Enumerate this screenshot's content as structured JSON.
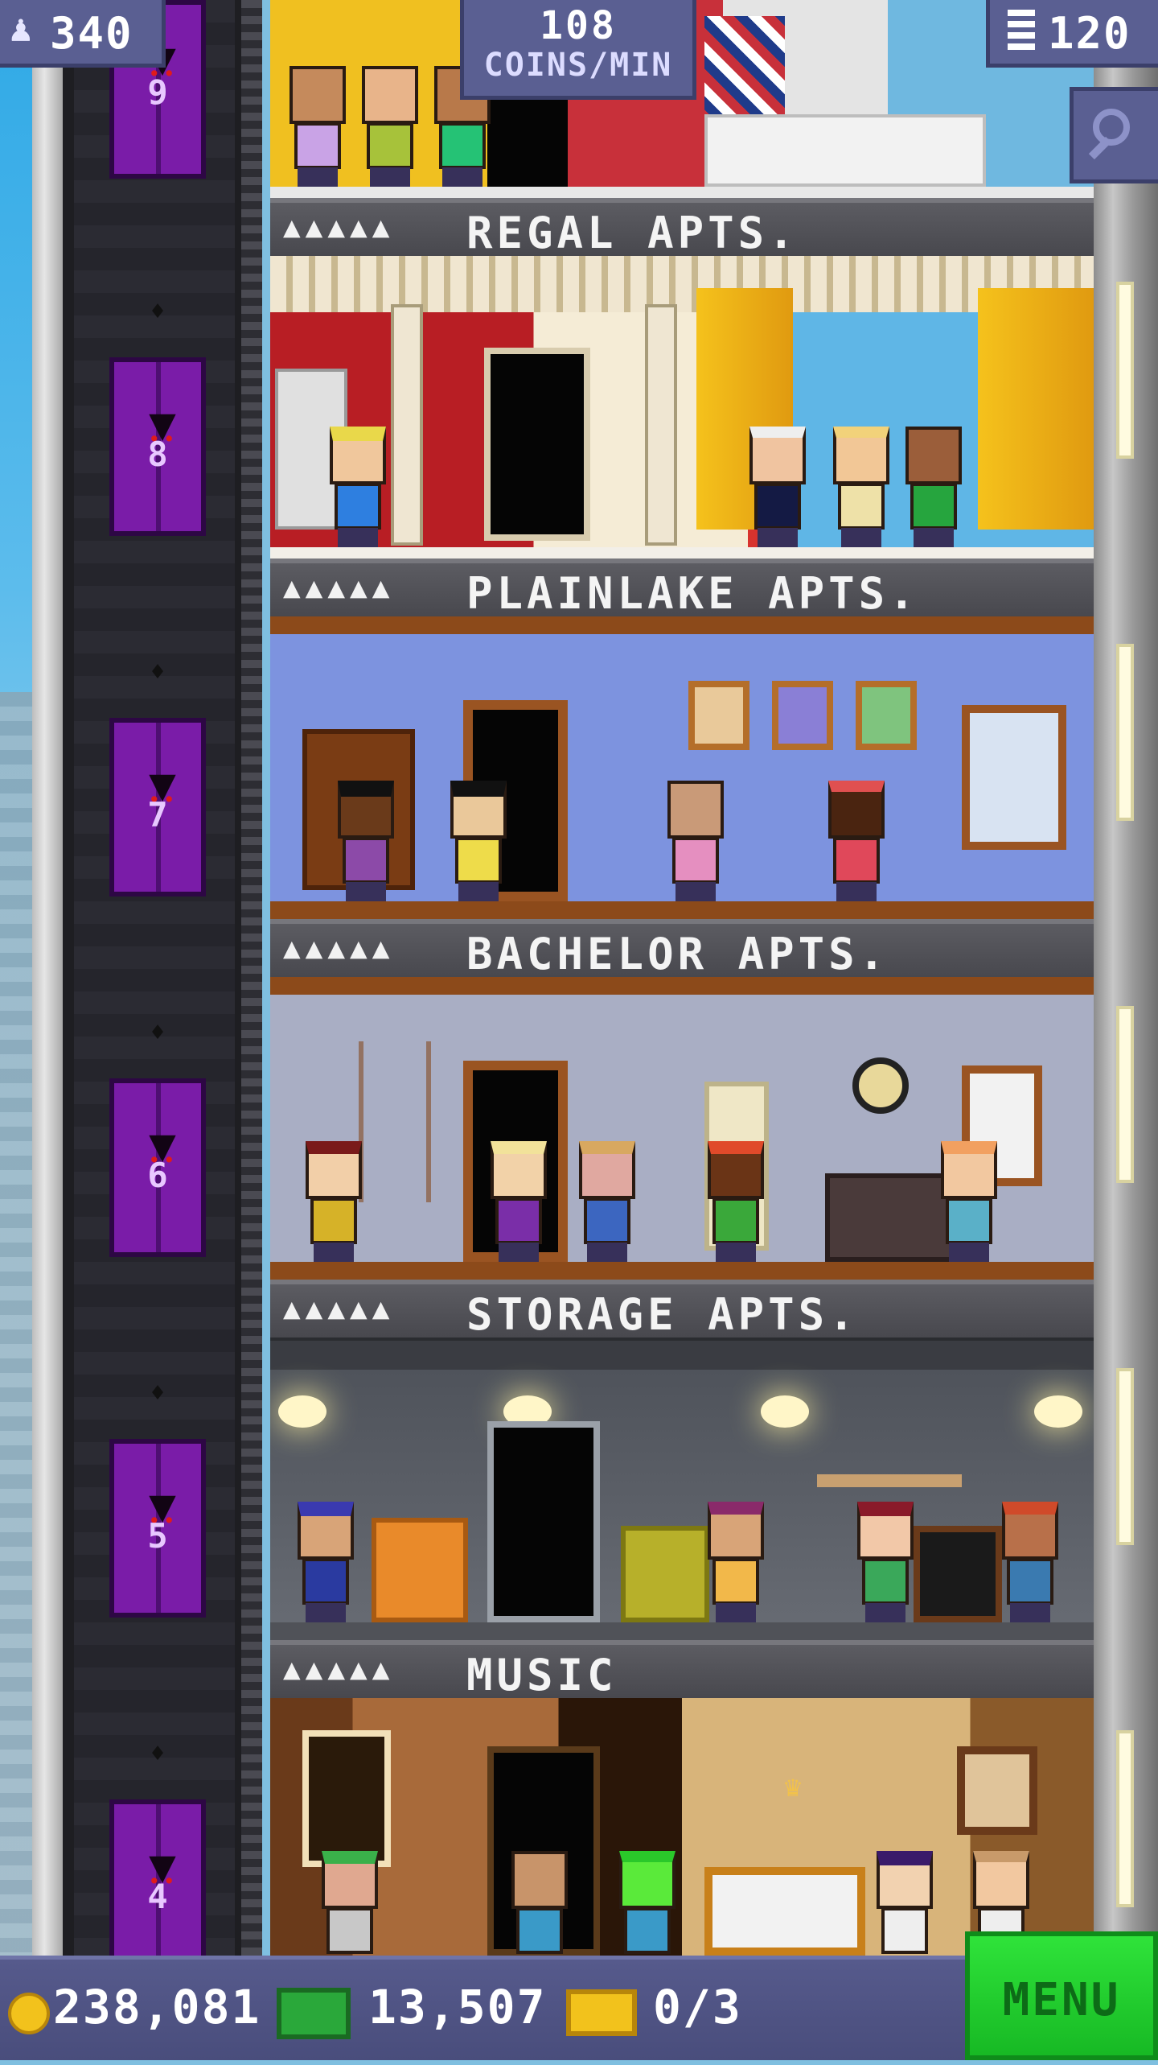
{
  "hud": {
    "population": "340",
    "coins_per_min_value": "108",
    "coins_per_min_label": "COINS/MIN",
    "floor_count": "120"
  },
  "floors": [
    {
      "name": "REGAL APTS.",
      "stars": "▲▲▲▲▲"
    },
    {
      "name": "PLAINLAKE APTS.",
      "stars": "▲▲▲▲▲"
    },
    {
      "name": "BACHELOR APTS.",
      "stars": "▲▲▲▲▲"
    },
    {
      "name": "STORAGE APTS.",
      "stars": "▲▲▲▲▲"
    },
    {
      "name": "MUSIC",
      "stars": "▲▲▲▲▲"
    }
  ],
  "elevator_numbers": [
    "9",
    "8",
    "7",
    "6",
    "5",
    "4"
  ],
  "bottom_bar": {
    "coins": "238,081",
    "bux": "13,507",
    "tickets": "0/3",
    "menu_label": "MENU"
  },
  "icons": {
    "population": "person-up-icon",
    "floors": "building-icon",
    "search": "magnifier-icon",
    "coins": "coin-icon",
    "bux": "bux-icon",
    "ticket": "ticket-icon"
  },
  "colors": {
    "hud_bg": "#5a5f92",
    "menu_green": "#2fe33a",
    "elevator_purple": "#7a1ca8"
  }
}
